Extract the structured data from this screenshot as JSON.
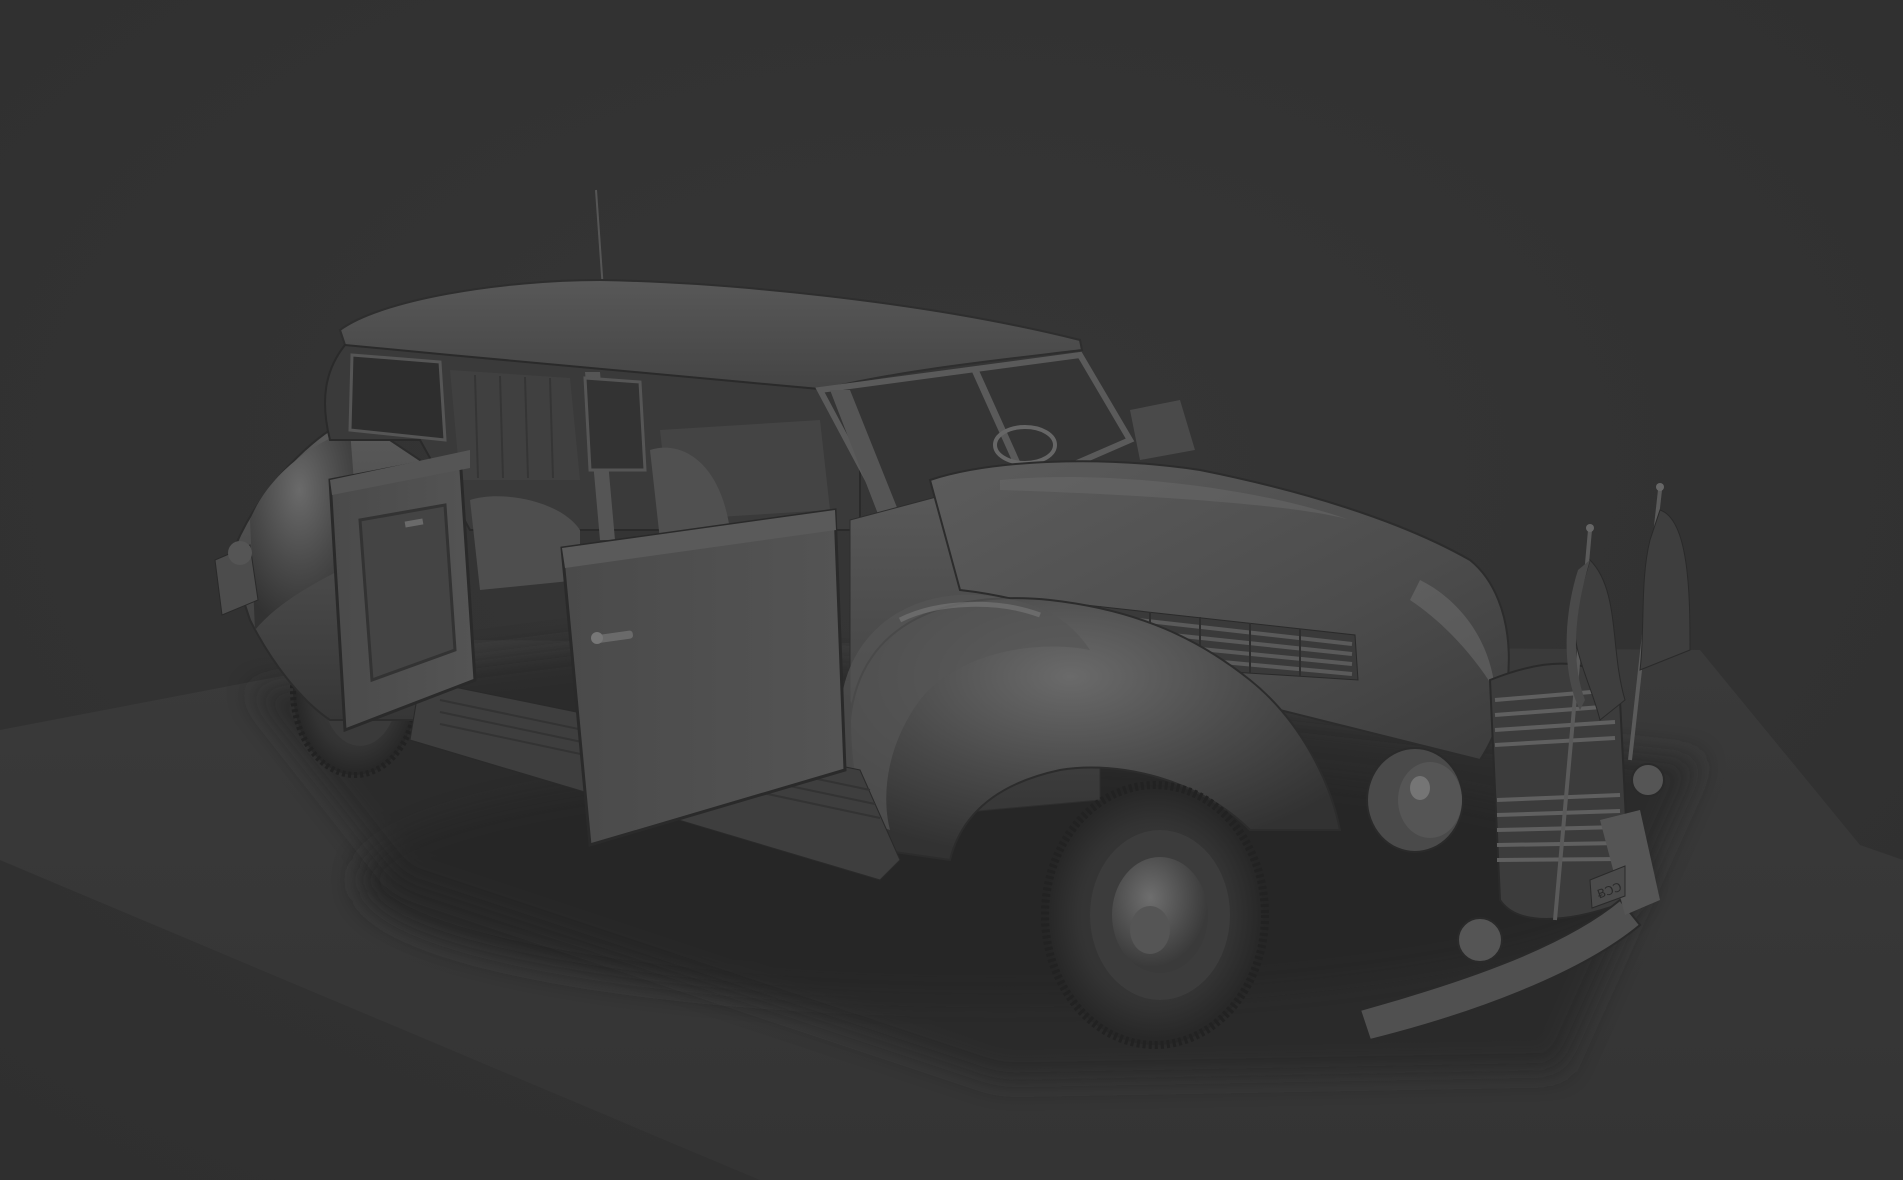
{
  "viewport": {
    "background_color": "#323232",
    "floor_color": "#3a3a3a",
    "shadow_color": "#2a2a2a"
  },
  "model": {
    "subject": "vintage-limousine",
    "material_color": "#4a4a4a",
    "highlight_color": "#8a8a8a",
    "dark_color": "#262626",
    "doors_open": [
      "front-left-door",
      "rear-left-door"
    ],
    "flags": 2,
    "plate_text": "ɃƆƆ"
  }
}
